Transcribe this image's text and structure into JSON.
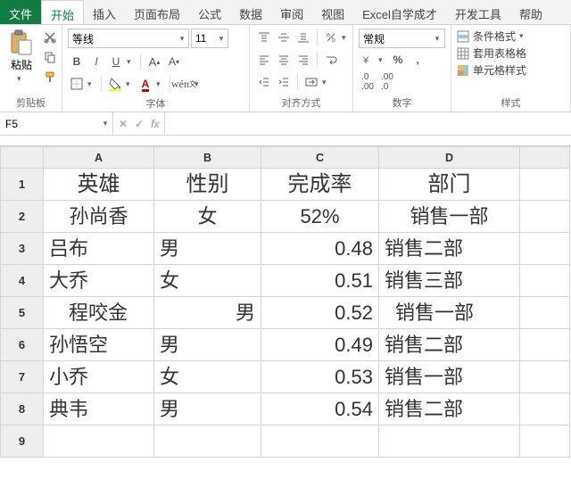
{
  "tabs": {
    "file": "文件",
    "home": "开始",
    "insert": "插入",
    "layout": "页面布局",
    "formulas": "公式",
    "data": "数据",
    "review": "审阅",
    "view": "视图",
    "excel_self": "Excel自学成才",
    "dev": "开发工具",
    "help": "帮助"
  },
  "ribbon": {
    "clipboard": {
      "paste": "粘贴",
      "label": "剪贴板"
    },
    "font": {
      "name": "等线",
      "size": "11",
      "label": "字体"
    },
    "alignment": {
      "label": "对齐方式"
    },
    "number": {
      "format": "常规",
      "label": "数字"
    },
    "styles": {
      "cond": "条件格式",
      "table": "套用表格格",
      "cell": "单元格样式",
      "label": "样式"
    }
  },
  "fx_bar": {
    "name_box": "F5",
    "fx_label": "fx"
  },
  "columns": {
    "A": "A",
    "B": "B",
    "C": "C",
    "D": "D"
  },
  "sheet": {
    "headers": {
      "A": "英雄",
      "B": "性别",
      "C": "完成率",
      "D": "部门"
    },
    "rows": [
      {
        "n": "2",
        "A": "孙尚香",
        "B": "女",
        "C": "52%",
        "D": "销售一部",
        "center": true
      },
      {
        "n": "3",
        "A": "吕布",
        "B": "男",
        "C": "0.48",
        "D": "销售二部"
      },
      {
        "n": "4",
        "A": "大乔",
        "B": "女",
        "C": "0.51",
        "D": "销售三部"
      },
      {
        "n": "5",
        "A": "程咬金",
        "B": "男",
        "C": "0.52",
        "D": "销售一部",
        "indent": true
      },
      {
        "n": "6",
        "A": "孙悟空",
        "B": "男",
        "C": "0.49",
        "D": "销售二部"
      },
      {
        "n": "7",
        "A": "小乔",
        "B": "女",
        "C": "0.53",
        "D": "销售一部"
      },
      {
        "n": "8",
        "A": "典韦",
        "B": "男",
        "C": "0.54",
        "D": "销售二部"
      }
    ],
    "extra_row": "9"
  }
}
